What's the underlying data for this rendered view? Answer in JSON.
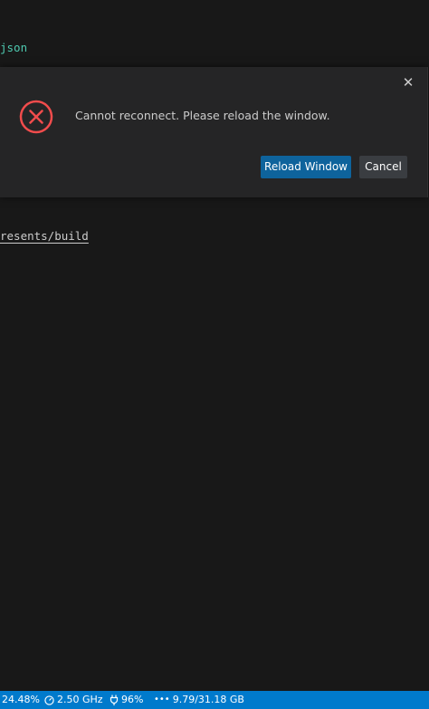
{
  "editor": {
    "line_json": "json",
    "line_path": "resents/build"
  },
  "dialog": {
    "message": "Cannot reconnect. Please reload the window.",
    "close_glyph": "✕",
    "reload_label": "Reload Window",
    "cancel_label": "Cancel",
    "error_color": "#f14c4c",
    "primary_color": "#0e639c"
  },
  "statusbar": {
    "cpu_usage": "24.48%",
    "cpu_freq": "2.50 GHz",
    "battery": "96%",
    "memory": "9.79/31.18 GB",
    "icons": [
      "gauge-icon",
      "plug-icon",
      "ellipsis-icon"
    ],
    "color": "#007acc"
  }
}
